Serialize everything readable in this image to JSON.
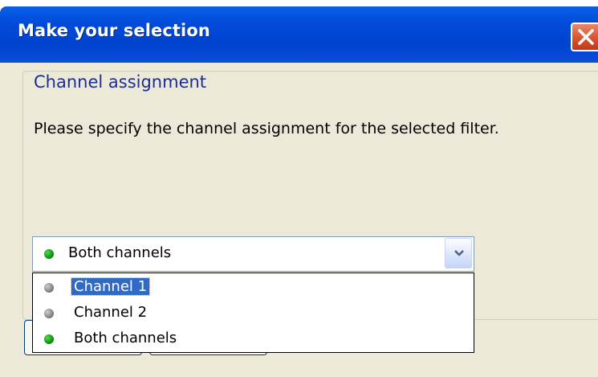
{
  "dialog": {
    "title": "Make your selection",
    "group_title": "Channel assignment",
    "description": "Please specify the channel assignment for the selected filter."
  },
  "combo": {
    "selected_value": "Both channels",
    "selected_icon": "green-dot-icon",
    "options": [
      {
        "label": "Channel 1",
        "icon": "gray-dot-icon",
        "highlighted": true
      },
      {
        "label": "Channel 2",
        "icon": "gray-dot-icon",
        "highlighted": false
      },
      {
        "label": "Both channels",
        "icon": "green-dot-icon",
        "highlighted": false
      }
    ]
  },
  "colors": {
    "titlebar": "#0049d8",
    "client_bg": "#ece9d8",
    "group_title": "#1b2f92",
    "selection": "#316ac5",
    "active_dot": "#129812",
    "inactive_dot": "#8a8a8a"
  }
}
